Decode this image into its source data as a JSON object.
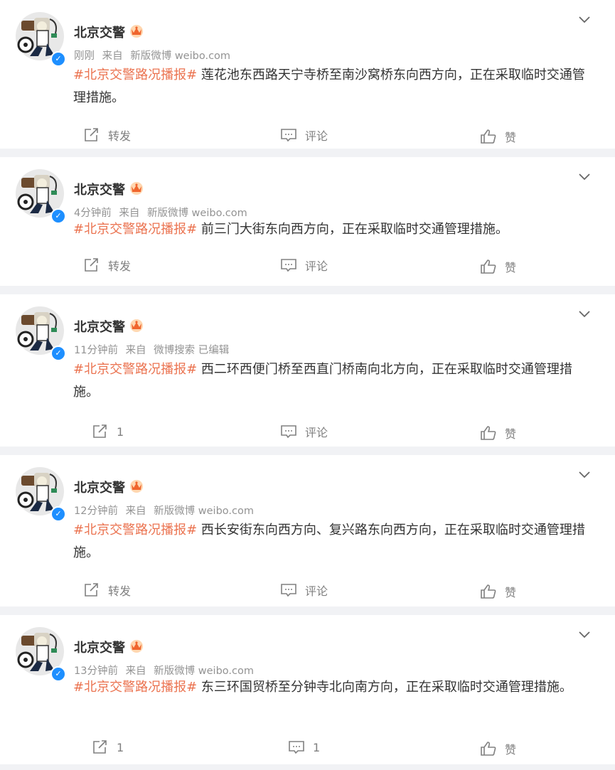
{
  "accent_topic_color": "#eb7350",
  "posts": [
    {
      "author": "北京交警",
      "time": "刚刚",
      "source_prefix": "来自",
      "source": "新版微博 weibo.com",
      "topic": "#北京交警路况播报#",
      "text": " 莲花池东西路天宁寺桥至南沙窝桥东向西方向，正在采取临时交通管理措施。",
      "repost_label": "转发",
      "comment_label": "评论",
      "like_label": "赞"
    },
    {
      "author": "北京交警",
      "time": "4分钟前",
      "source_prefix": "来自",
      "source": "新版微博 weibo.com",
      "topic": "#北京交警路况播报#",
      "text": " 前三门大街东向西方向，正在采取临时交通管理措施。",
      "repost_label": "转发",
      "comment_label": "评论",
      "like_label": "赞"
    },
    {
      "author": "北京交警",
      "time": "11分钟前",
      "source_prefix": "来自",
      "source": "微博搜索 已编辑",
      "topic": "#北京交警路况播报#",
      "text": " 西二环西便门桥至西直门桥南向北方向，正在采取临时交通管理措施。",
      "repost_label": "1",
      "comment_label": "评论",
      "like_label": "赞"
    },
    {
      "author": "北京交警",
      "time": "12分钟前",
      "source_prefix": "来自",
      "source": "新版微博 weibo.com",
      "topic": "#北京交警路况播报#",
      "text": " 西长安街东向西方向、复兴路东向西方向，正在采取临时交通管理措施。",
      "repost_label": "转发",
      "comment_label": "评论",
      "like_label": "赞"
    },
    {
      "author": "北京交警",
      "time": "13分钟前",
      "source_prefix": "来自",
      "source": "新版微博 weibo.com",
      "topic": "#北京交警路况播报#",
      "text": " 东三环国贸桥至分钟寺北向南方向，正在采取临时交通管理措施。",
      "repost_label": "1",
      "comment_label": "1",
      "like_label": "赞"
    }
  ]
}
